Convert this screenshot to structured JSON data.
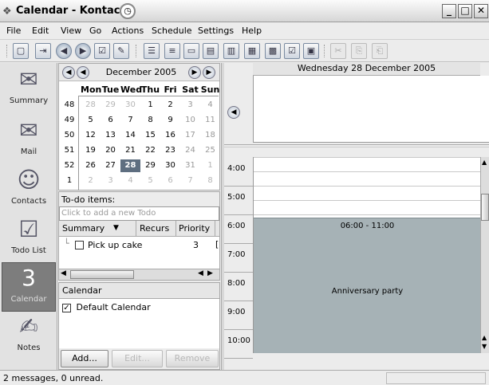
{
  "window": {
    "title": "Calendar - Kontact"
  },
  "menubar": {
    "items": [
      "File",
      "Edit",
      "View",
      "Go",
      "Actions",
      "Schedule",
      "Settings",
      "Help"
    ]
  },
  "sidebar": {
    "items": [
      {
        "label": "Summary",
        "icon": "summary-icon"
      },
      {
        "label": "Mail",
        "icon": "mail-icon"
      },
      {
        "label": "Contacts",
        "icon": "contacts-icon"
      },
      {
        "label": "Todo List",
        "icon": "todo-list-icon"
      },
      {
        "label": "Calendar",
        "icon": "calendar-icon",
        "active": true
      },
      {
        "label": "Notes",
        "icon": "notes-icon"
      }
    ]
  },
  "datenav": {
    "month": "December 2005",
    "weekdays": [
      "Mon",
      "Tue",
      "Wed",
      "Thu",
      "Fri",
      "Sat",
      "Sun"
    ],
    "weeks": [
      {
        "num": "48",
        "days": [
          "28",
          "29",
          "30",
          "1",
          "2",
          "3",
          "4"
        ]
      },
      {
        "num": "49",
        "days": [
          "5",
          "6",
          "7",
          "8",
          "9",
          "10",
          "11"
        ]
      },
      {
        "num": "50",
        "days": [
          "12",
          "13",
          "14",
          "15",
          "16",
          "17",
          "18"
        ]
      },
      {
        "num": "51",
        "days": [
          "19",
          "20",
          "21",
          "22",
          "23",
          "24",
          "25"
        ]
      },
      {
        "num": "52",
        "days": [
          "26",
          "27",
          "28",
          "29",
          "30",
          "31",
          "1"
        ]
      },
      {
        "num": "1",
        "days": [
          "2",
          "3",
          "4",
          "5",
          "6",
          "7",
          "8"
        ]
      }
    ],
    "today": "28"
  },
  "todo": {
    "title": "To-do items:",
    "placeholder": "Click to add a new Todo",
    "columns": {
      "summary": "Summary",
      "recurs": "Recurs",
      "priority": "Priority"
    },
    "items": [
      {
        "summary": "Pick up cake",
        "priority": "3"
      }
    ]
  },
  "calendars": {
    "title": "Calendar",
    "items": [
      {
        "name": "Default Calendar",
        "checked": true
      }
    ],
    "buttons": {
      "add": "Add...",
      "edit": "Edit...",
      "remove": "Remove"
    }
  },
  "agenda": {
    "date": "Wednesday 28 December 2005",
    "hours": [
      "4:00",
      "5:00",
      "6:00",
      "7:00",
      "8:00",
      "9:00",
      "10:00"
    ],
    "event": {
      "time": "06:00 - 11:00",
      "name": "Anniversary party"
    }
  },
  "status": {
    "text": "2 messages, 0 unread."
  }
}
